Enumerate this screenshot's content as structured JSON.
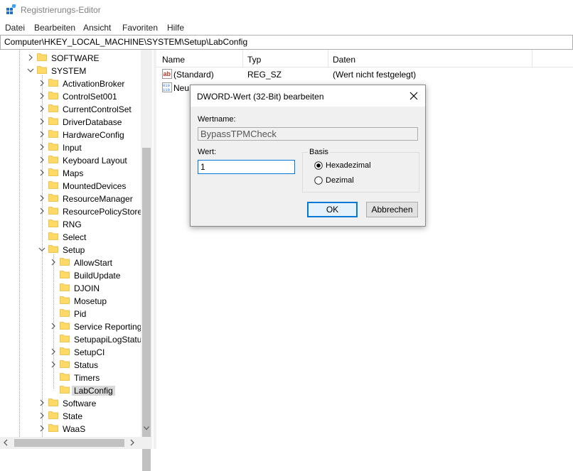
{
  "window": {
    "title": "Registrierungs-Editor"
  },
  "menu": [
    "Datei",
    "Bearbeiten",
    "Ansicht",
    "Favoriten",
    "Hilfe"
  ],
  "address": "Computer\\HKEY_LOCAL_MACHINE\\SYSTEM\\Setup\\LabConfig",
  "tree": {
    "items": [
      {
        "label": "SOFTWARE",
        "level": 0,
        "chevron": "right"
      },
      {
        "label": "SYSTEM",
        "level": 0,
        "chevron": "down"
      },
      {
        "label": "ActivationBroker",
        "level": 1,
        "chevron": "right"
      },
      {
        "label": "ControlSet001",
        "level": 1,
        "chevron": "right"
      },
      {
        "label": "CurrentControlSet",
        "level": 1,
        "chevron": "right"
      },
      {
        "label": "DriverDatabase",
        "level": 1,
        "chevron": "right"
      },
      {
        "label": "HardwareConfig",
        "level": 1,
        "chevron": "right"
      },
      {
        "label": "Input",
        "level": 1,
        "chevron": "right"
      },
      {
        "label": "Keyboard Layout",
        "level": 1,
        "chevron": "right"
      },
      {
        "label": "Maps",
        "level": 1,
        "chevron": "right"
      },
      {
        "label": "MountedDevices",
        "level": 1,
        "chevron": "none"
      },
      {
        "label": "ResourceManager",
        "level": 1,
        "chevron": "right"
      },
      {
        "label": "ResourcePolicyStore",
        "level": 1,
        "chevron": "right"
      },
      {
        "label": "RNG",
        "level": 1,
        "chevron": "none"
      },
      {
        "label": "Select",
        "level": 1,
        "chevron": "none"
      },
      {
        "label": "Setup",
        "level": 1,
        "chevron": "down"
      },
      {
        "label": "AllowStart",
        "level": 2,
        "chevron": "right"
      },
      {
        "label": "BuildUpdate",
        "level": 2,
        "chevron": "none"
      },
      {
        "label": "DJOIN",
        "level": 2,
        "chevron": "none"
      },
      {
        "label": "Mosetup",
        "level": 2,
        "chevron": "none"
      },
      {
        "label": "Pid",
        "level": 2,
        "chevron": "none"
      },
      {
        "label": "Service Reporting",
        "level": 2,
        "chevron": "right"
      },
      {
        "label": "SetupapiLogStatu",
        "level": 2,
        "chevron": "none"
      },
      {
        "label": "SetupCI",
        "level": 2,
        "chevron": "right"
      },
      {
        "label": "Status",
        "level": 2,
        "chevron": "right"
      },
      {
        "label": "Timers",
        "level": 2,
        "chevron": "none"
      },
      {
        "label": "LabConfig",
        "level": 2,
        "chevron": "none",
        "selected": true
      },
      {
        "label": "Software",
        "level": 1,
        "chevron": "right"
      },
      {
        "label": "State",
        "level": 1,
        "chevron": "right"
      },
      {
        "label": "WaaS",
        "level": 1,
        "chevron": "right"
      }
    ]
  },
  "list": {
    "columns": [
      "Name",
      "Typ",
      "Daten"
    ],
    "rows": [
      {
        "name": "(Standard)",
        "type": "REG_SZ",
        "data": "(Wert nicht festgelegt)",
        "icon": "string-value-icon"
      },
      {
        "name": "Neu",
        "type": "",
        "data": "",
        "icon": "binary-value-icon"
      }
    ]
  },
  "dialog": {
    "title": "DWORD-Wert (32-Bit) bearbeiten",
    "name_label": "Wertname:",
    "name_value": "BypassTPMCheck",
    "value_label": "Wert:",
    "value": "1",
    "base_label": "Basis",
    "radio_hex": "Hexadezimal",
    "radio_dec": "Dezimal",
    "selected_base": "hex",
    "ok_label": "OK",
    "cancel_label": "Abbrechen"
  },
  "colors": {
    "accent": "#0078d7",
    "folder": "#ffd966",
    "folder_dark": "#e8b83a"
  }
}
